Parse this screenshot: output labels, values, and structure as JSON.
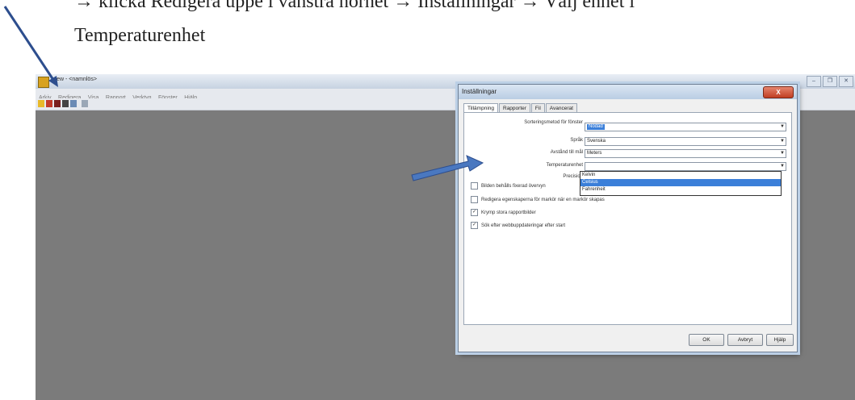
{
  "instruction": {
    "line1": "→ klicka Redigera uppe i vänstra hörnet → Inställningar → Välj enhet i",
    "line2": "Temperaturenhet"
  },
  "app": {
    "title": "View - <namnlös>",
    "menu": [
      "Arkiv",
      "Redigera",
      "Visa",
      "Rapport",
      "Verktyg",
      "Fönster",
      "Hjälp"
    ],
    "window_controls": [
      "‒",
      "❐",
      "✕"
    ]
  },
  "dialog": {
    "title": "Inställningar",
    "close_label": "X",
    "tabs": [
      "Tillämpning",
      "Rapporter",
      "Fil",
      "Avancerat"
    ],
    "fields": [
      {
        "label": "Sorteringsmetod för fönster",
        "value": "Nodad"
      },
      {
        "label": "Språk",
        "value": "Svenska"
      },
      {
        "label": "Avstånd till mål",
        "value": "Meters"
      },
      {
        "label": "Temperaturenhet",
        "value": ""
      },
      {
        "label": "Precision",
        "value": ""
      }
    ],
    "dropdown_options": [
      "Kelvin",
      "Celsius",
      "Fahrenheit"
    ],
    "dropdown_selected": "Celsius",
    "checkboxes": [
      {
        "label": "Bilden behålls fixerad övervyn",
        "checked": false
      },
      {
        "label": "Redigera egenskaperna för markör när en markör skapas",
        "checked": false
      },
      {
        "label": "Krymp stora rapportbilder",
        "checked": true
      },
      {
        "label": "Sök efter webbuppdateringar efter start",
        "checked": true
      }
    ],
    "buttons": {
      "ok": "OK",
      "cancel": "Avbryt",
      "help": "Hjälp"
    }
  },
  "colors": {
    "desktop": "#7b7b7b",
    "highlight": "#3b7fd9",
    "arrow_fill": "#4a78c0"
  }
}
